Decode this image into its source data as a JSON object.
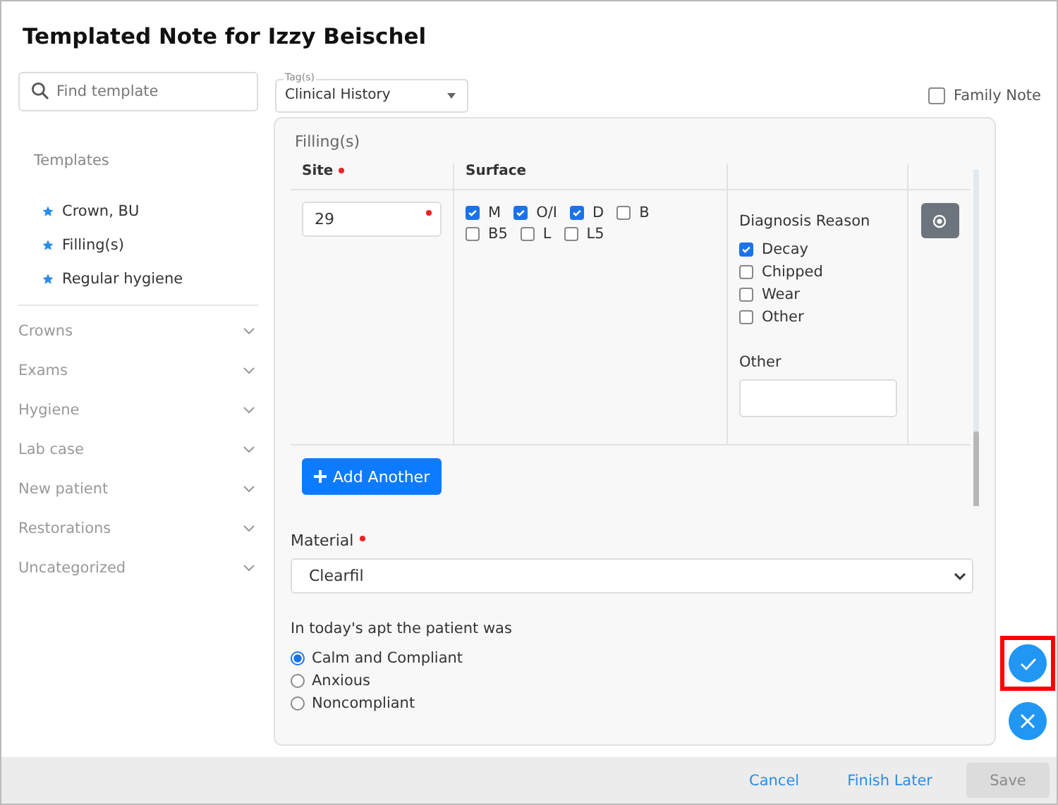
{
  "dialog": {
    "title": "Templated Note for Izzy Beischel"
  },
  "search": {
    "placeholder": "Find template"
  },
  "tags": {
    "label": "Tag(s)",
    "value": "Clinical History"
  },
  "family_note": {
    "label": "Family Note",
    "checked": false
  },
  "sidebar": {
    "heading": "Templates",
    "favorites": [
      "Crown, BU",
      "Filling(s)",
      "Regular hygiene"
    ],
    "categories": [
      {
        "label": "Crowns",
        "expanded": false
      },
      {
        "label": "Exams",
        "expanded": false
      },
      {
        "label": "Hygiene",
        "expanded": false
      },
      {
        "label": "Lab case",
        "expanded": false
      },
      {
        "label": "New patient",
        "expanded": false
      },
      {
        "label": "Restorations",
        "expanded": false
      },
      {
        "label": "Uncategorized",
        "expanded": false
      }
    ]
  },
  "panel": {
    "title": "Filling(s)",
    "columns": [
      {
        "label": "Site",
        "required": true
      },
      {
        "label": "Surface",
        "required": false
      }
    ],
    "rows": [
      {
        "site": "29",
        "site_required": true,
        "surfaces": [
          {
            "label": "M",
            "checked": true
          },
          {
            "label": "O/I",
            "checked": true
          },
          {
            "label": "D",
            "checked": true
          },
          {
            "label": "B",
            "checked": false
          },
          {
            "label": "B5",
            "checked": false
          },
          {
            "label": "L",
            "checked": false
          },
          {
            "label": "L5",
            "checked": false
          }
        ],
        "diagnosis_label": "Diagnosis Reason",
        "reasons": [
          {
            "label": "Decay",
            "checked": true
          },
          {
            "label": "Chipped",
            "checked": false
          },
          {
            "label": "Wear",
            "checked": false
          },
          {
            "label": "Other",
            "checked": false
          }
        ],
        "other_label": "Other"
      }
    ],
    "add_button": "Add Another",
    "material": {
      "label": "Material",
      "required": true,
      "value": "Clearfil"
    },
    "behavior": {
      "label": "In today's apt the patient was",
      "options": [
        {
          "label": "Calm and Compliant",
          "selected": true
        },
        {
          "label": "Anxious",
          "selected": false
        },
        {
          "label": "Noncompliant",
          "selected": false
        }
      ]
    }
  },
  "fabs": [
    {
      "kind": "confirm",
      "highlighted": true
    },
    {
      "kind": "dismiss",
      "highlighted": false
    }
  ],
  "footer": {
    "buttons": [
      {
        "label": "Cancel",
        "kind": "link",
        "disabled": false
      },
      {
        "label": "Finish Later",
        "kind": "link",
        "disabled": false
      },
      {
        "label": "Save",
        "kind": "primary",
        "disabled": true
      }
    ]
  }
}
